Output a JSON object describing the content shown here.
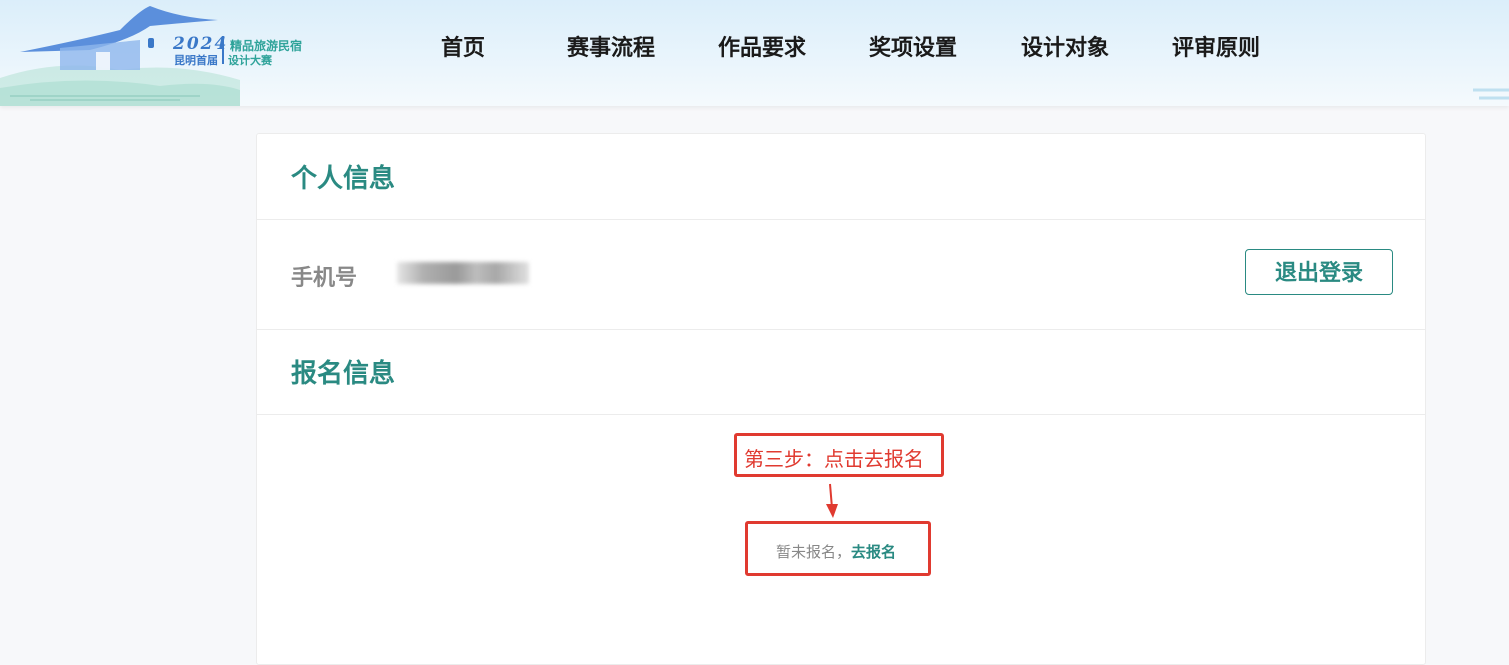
{
  "logo": {
    "year": "2024",
    "line1": "精品旅游民宿",
    "line2": "昆明首届",
    "line3": "设计大赛"
  },
  "nav": {
    "items": [
      "首页",
      "赛事流程",
      "作品要求",
      "奖项设置",
      "设计对象",
      "评审原则"
    ]
  },
  "profile": {
    "personal_title": "个人信息",
    "phone_label": "手机号",
    "logout_label": "退出登录",
    "registration_title": "报名信息",
    "status_text": "暂未报名，",
    "register_link": "去报名"
  },
  "annotation": {
    "step_text": "第三步：点击去报名"
  },
  "colors": {
    "accent": "#2a8a82",
    "annotation": "#e03a30",
    "logo_blue": "#3a78c8"
  }
}
